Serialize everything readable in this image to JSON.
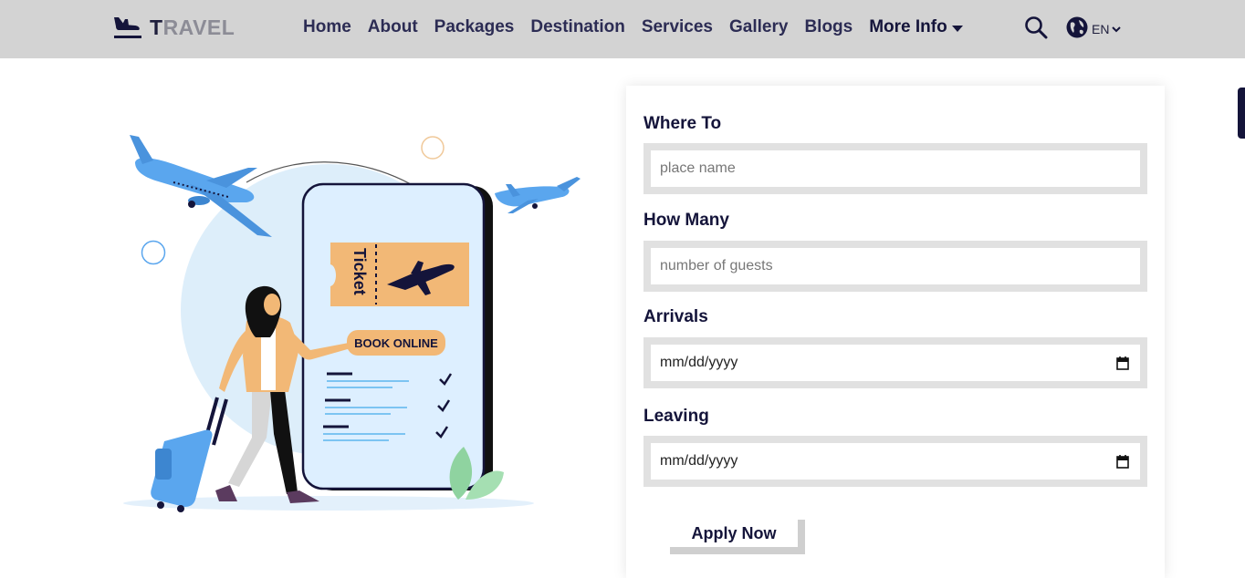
{
  "header": {
    "logo": {
      "first_letter": "T",
      "rest": "RAVEL"
    },
    "nav": [
      "Home",
      "About",
      "Packages",
      "Destination",
      "Services",
      "Gallery",
      "Blogs"
    ],
    "more_info": "More Info",
    "language": "EN",
    "icons": {
      "logo": "plane-landing-icon",
      "search": "search-icon",
      "language": "globe-icon"
    }
  },
  "illustration": {
    "ticket_text": "Ticket",
    "book_button": "BOOK ONLINE"
  },
  "form": {
    "where_to": {
      "label": "Where To",
      "placeholder": "place name"
    },
    "how_many": {
      "label": "How Many",
      "placeholder": "number of guests"
    },
    "arrivals": {
      "label": "Arrivals",
      "value": "mm/dd/yyyy"
    },
    "leaving": {
      "label": "Leaving",
      "value": "mm/dd/yyyy"
    },
    "apply": "Apply Now"
  },
  "colors": {
    "header_bg": "#d3d3d3",
    "nav_text": "#2c2c54",
    "field_border": "#e1e1e1",
    "accent_blue": "#5aa6ee",
    "ticket_orange": "#f2b876"
  }
}
